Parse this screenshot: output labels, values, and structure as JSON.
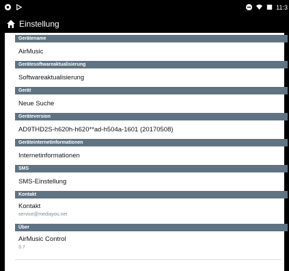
{
  "status_bar": {
    "time": "11:3"
  },
  "app_bar": {
    "title": "Einstellung"
  },
  "sections": [
    {
      "header": "Gerätename",
      "label": "AirMusic",
      "sub": ""
    },
    {
      "header": "Gerätesoftwareaktualisierung",
      "label": "Softwareaktualisierung",
      "sub": ""
    },
    {
      "header": "Gerät",
      "label": "Neue Suche",
      "sub": ""
    },
    {
      "header": "Geräteversion",
      "label": "AD9THD2S-h620h-h620**ad-h504a-1601 (20170508)",
      "sub": ""
    },
    {
      "header": "Geräteinternetinformationen",
      "label": "Internetinformationen",
      "sub": ""
    },
    {
      "header": "SMS",
      "label": "SMS-Einstellung",
      "sub": ""
    },
    {
      "header": "Kontakt",
      "label": "Kontakt",
      "sub": "service@mediayou.net"
    },
    {
      "header": "Über",
      "label": "AirMusic Control",
      "sub": "3.7"
    }
  ],
  "icons": {
    "home": "home-icon"
  }
}
